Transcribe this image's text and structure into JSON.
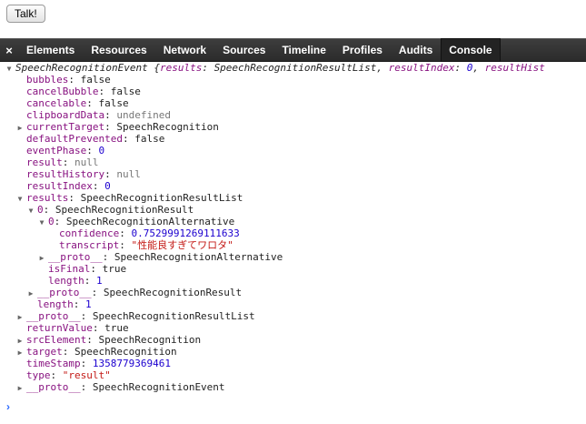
{
  "top": {
    "talk_button": "Talk!"
  },
  "devtools": {
    "close": "×",
    "tabs": [
      {
        "label": "Elements"
      },
      {
        "label": "Resources"
      },
      {
        "label": "Network"
      },
      {
        "label": "Sources"
      },
      {
        "label": "Timeline"
      },
      {
        "label": "Profiles"
      },
      {
        "label": "Audits"
      },
      {
        "label": "Console"
      }
    ]
  },
  "console": {
    "lines": [
      {
        "indent": 0,
        "arrow": "expanded",
        "parts": [
          {
            "t": "SpeechRecognitionEvent {",
            "c": "italic"
          },
          {
            "t": "results",
            "c": "italic k"
          },
          {
            "t": ": ",
            "c": "italic"
          },
          {
            "t": "SpeechRecognitionResultList",
            "c": "italic"
          },
          {
            "t": ", ",
            "c": "italic"
          },
          {
            "t": "resultIndex",
            "c": "italic k"
          },
          {
            "t": ": ",
            "c": "italic"
          },
          {
            "t": "0",
            "c": "italic num"
          },
          {
            "t": ", ",
            "c": "italic"
          },
          {
            "t": "resultHist",
            "c": "italic k"
          }
        ]
      },
      {
        "indent": 1,
        "parts": [
          {
            "t": "bubbles",
            "c": "k"
          },
          {
            "t": ": false"
          }
        ]
      },
      {
        "indent": 1,
        "parts": [
          {
            "t": "cancelBubble",
            "c": "k"
          },
          {
            "t": ": false"
          }
        ]
      },
      {
        "indent": 1,
        "parts": [
          {
            "t": "cancelable",
            "c": "k"
          },
          {
            "t": ": false"
          }
        ]
      },
      {
        "indent": 1,
        "parts": [
          {
            "t": "clipboardData",
            "c": "k"
          },
          {
            "t": ": "
          },
          {
            "t": "undefined",
            "c": "gray"
          }
        ]
      },
      {
        "indent": 1,
        "arrow": "collapsed",
        "parts": [
          {
            "t": "currentTarget",
            "c": "k"
          },
          {
            "t": ": SpeechRecognition"
          }
        ]
      },
      {
        "indent": 1,
        "parts": [
          {
            "t": "defaultPrevented",
            "c": "k"
          },
          {
            "t": ": false"
          }
        ]
      },
      {
        "indent": 1,
        "parts": [
          {
            "t": "eventPhase",
            "c": "k"
          },
          {
            "t": ": "
          },
          {
            "t": "0",
            "c": "num"
          }
        ]
      },
      {
        "indent": 1,
        "parts": [
          {
            "t": "result",
            "c": "k"
          },
          {
            "t": ": "
          },
          {
            "t": "null",
            "c": "gray"
          }
        ]
      },
      {
        "indent": 1,
        "parts": [
          {
            "t": "resultHistory",
            "c": "k"
          },
          {
            "t": ": "
          },
          {
            "t": "null",
            "c": "gray"
          }
        ]
      },
      {
        "indent": 1,
        "parts": [
          {
            "t": "resultIndex",
            "c": "k"
          },
          {
            "t": ": "
          },
          {
            "t": "0",
            "c": "num"
          }
        ]
      },
      {
        "indent": 1,
        "arrow": "expanded",
        "parts": [
          {
            "t": "results",
            "c": "k"
          },
          {
            "t": ": SpeechRecognitionResultList"
          }
        ]
      },
      {
        "indent": 2,
        "arrow": "expanded",
        "parts": [
          {
            "t": "0",
            "c": "k"
          },
          {
            "t": ": SpeechRecognitionResult"
          }
        ]
      },
      {
        "indent": 3,
        "arrow": "expanded",
        "parts": [
          {
            "t": "0",
            "c": "k"
          },
          {
            "t": ": SpeechRecognitionAlternative"
          }
        ]
      },
      {
        "indent": 4,
        "parts": [
          {
            "t": "confidence",
            "c": "k"
          },
          {
            "t": ": "
          },
          {
            "t": "0.7529991269111633",
            "c": "num"
          }
        ]
      },
      {
        "indent": 4,
        "parts": [
          {
            "t": "transcript",
            "c": "k"
          },
          {
            "t": ": "
          },
          {
            "t": "\"性能良すぎてワロタ\"",
            "c": "str"
          }
        ]
      },
      {
        "indent": 3,
        "arrow": "collapsed",
        "parts": [
          {
            "t": "__proto__",
            "c": "k"
          },
          {
            "t": ": SpeechRecognitionAlternative"
          }
        ]
      },
      {
        "indent": 3,
        "parts": [
          {
            "t": "isFinal",
            "c": "k"
          },
          {
            "t": ": true"
          }
        ]
      },
      {
        "indent": 3,
        "parts": [
          {
            "t": "length",
            "c": "k"
          },
          {
            "t": ": "
          },
          {
            "t": "1",
            "c": "num"
          }
        ]
      },
      {
        "indent": 2,
        "arrow": "collapsed",
        "parts": [
          {
            "t": "__proto__",
            "c": "k"
          },
          {
            "t": ": SpeechRecognitionResult"
          }
        ]
      },
      {
        "indent": 2,
        "parts": [
          {
            "t": "length",
            "c": "k"
          },
          {
            "t": ": "
          },
          {
            "t": "1",
            "c": "num"
          }
        ]
      },
      {
        "indent": 1,
        "arrow": "collapsed",
        "parts": [
          {
            "t": "__proto__",
            "c": "k"
          },
          {
            "t": ": SpeechRecognitionResultList"
          }
        ]
      },
      {
        "indent": 1,
        "parts": [
          {
            "t": "returnValue",
            "c": "k"
          },
          {
            "t": ": true"
          }
        ]
      },
      {
        "indent": 1,
        "arrow": "collapsed",
        "parts": [
          {
            "t": "srcElement",
            "c": "k"
          },
          {
            "t": ": SpeechRecognition"
          }
        ]
      },
      {
        "indent": 1,
        "arrow": "collapsed",
        "parts": [
          {
            "t": "target",
            "c": "k"
          },
          {
            "t": ": SpeechRecognition"
          }
        ]
      },
      {
        "indent": 1,
        "parts": [
          {
            "t": "timeStamp",
            "c": "k"
          },
          {
            "t": ": "
          },
          {
            "t": "1358779369461",
            "c": "num"
          }
        ]
      },
      {
        "indent": 1,
        "parts": [
          {
            "t": "type",
            "c": "k"
          },
          {
            "t": ": "
          },
          {
            "t": "\"result\"",
            "c": "str"
          }
        ]
      },
      {
        "indent": 1,
        "arrow": "collapsed",
        "parts": [
          {
            "t": "__proto__",
            "c": "k"
          },
          {
            "t": ": SpeechRecognitionEvent"
          }
        ]
      }
    ],
    "prompt": "›"
  }
}
